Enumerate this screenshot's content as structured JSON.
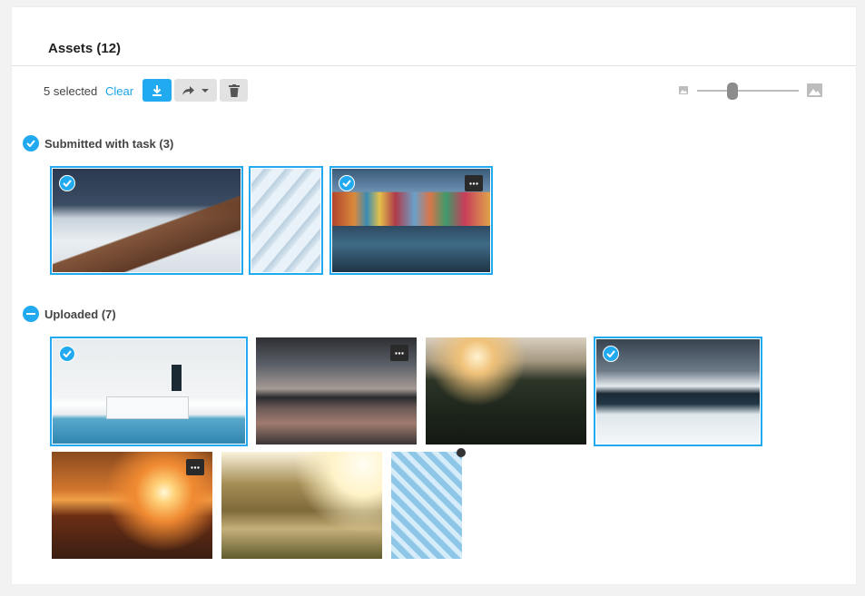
{
  "header": {
    "title": "Assets (12)"
  },
  "toolbar": {
    "selected_text": "5 selected",
    "clear_label": "Clear",
    "download_icon": "download-icon",
    "share_icon": "share-icon",
    "delete_icon": "trash-icon",
    "size_slider_value": 0.3
  },
  "groups": [
    {
      "label": "Submitted with task (3)",
      "state": "all-selected",
      "items": [
        {
          "name": "snowy-mountains",
          "selected": true,
          "comment": false
        },
        {
          "name": "white-architecture",
          "selected": true,
          "comment": false
        },
        {
          "name": "burano-canal",
          "selected": true,
          "comment": true
        }
      ]
    },
    {
      "label": "Uploaded (7)",
      "state": "partially-selected",
      "items": [
        {
          "name": "white-pool-building",
          "selected": true,
          "comment": false
        },
        {
          "name": "dusk-lake",
          "selected": false,
          "comment": true
        },
        {
          "name": "sunset-trail",
          "selected": false,
          "comment": false
        },
        {
          "name": "frozen-fjord",
          "selected": true,
          "comment": false
        },
        {
          "name": "coastal-sunset",
          "selected": false,
          "comment": true
        },
        {
          "name": "golden-valley",
          "selected": false,
          "comment": false
        },
        {
          "name": "glass-roof",
          "selected": false,
          "comment": false
        }
      ]
    }
  ],
  "colors": {
    "accent": "#22aaf0",
    "panel": "#ffffff",
    "background": "#f2f2f2"
  }
}
